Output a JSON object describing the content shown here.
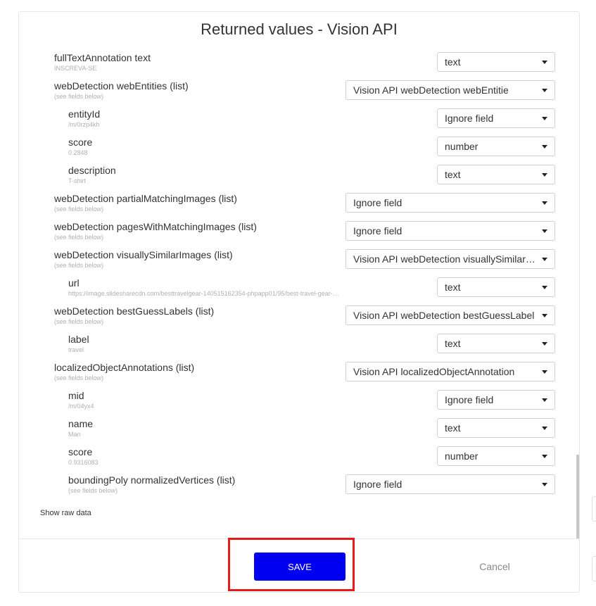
{
  "title": "Returned values - Vision API",
  "fields": [
    {
      "label": "fullTextAnnotation text",
      "sub": "INSCREVA-SE",
      "value": "text"
    },
    {
      "label": "webDetection webEntities (list)",
      "sub": "(see fields below)",
      "value": "Vision API webDetection webEntitie"
    },
    {
      "label": "entityId",
      "sub": "/m/0rzp4kh",
      "value": "Ignore field"
    },
    {
      "label": "score",
      "sub": "0.2848",
      "value": "number"
    },
    {
      "label": "description",
      "sub": "T-shirt",
      "value": "text"
    },
    {
      "label": "webDetection partialMatchingImages (list)",
      "sub": "(see fields below)",
      "value": "Ignore field"
    },
    {
      "label": "webDetection pagesWithMatchingImages (list)",
      "sub": "(see fields below)",
      "value": "Ignore field"
    },
    {
      "label": "webDetection visuallySimilarImages (list)",
      "sub": "(see fields below)",
      "value": "Vision API webDetection visuallySimilar…"
    },
    {
      "label": "url",
      "sub": "https://image.slidesharecdn.com/besttravelgear-140515162354-phpapp01/95/best-travel-gear-…",
      "value": "text"
    },
    {
      "label": "webDetection bestGuessLabels (list)",
      "sub": "(see fields below)",
      "value": "Vision API webDetection bestGuessLabel"
    },
    {
      "label": "label",
      "sub": "travel",
      "value": "text"
    },
    {
      "label": "localizedObjectAnnotations (list)",
      "sub": "(see fields below)",
      "value": "Vision API localizedObjectAnnotation"
    },
    {
      "label": "mid",
      "sub": "/m/04yx4",
      "value": "Ignore field"
    },
    {
      "label": "name",
      "sub": "Man",
      "value": "text"
    },
    {
      "label": "score",
      "sub": "0.9316083",
      "value": "number"
    },
    {
      "label": "boundingPoly normalizedVertices (list)",
      "sub": "(see fields below)",
      "value": "Ignore field"
    }
  ],
  "show_raw_label": "Show raw data",
  "save_label": "SAVE",
  "cancel_label": "Cancel",
  "colors": {
    "save_bg": "#0000f0",
    "highlight": "#e21b1b"
  }
}
